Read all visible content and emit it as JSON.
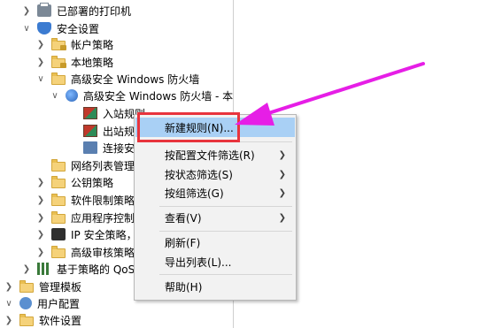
{
  "tree": {
    "printers": "已部署的打印机",
    "security_settings": "安全设置",
    "account_policy": "帐户策略",
    "local_policy": "本地策略",
    "advanced_firewall": "高级安全 Windows 防火墙",
    "advanced_firewall_local": "高级安全 Windows 防火墙 - 本",
    "inbound_rules": "入站规则",
    "outbound_rules": "出站规",
    "connection_security": "连接安",
    "network_list": "网络列表管理",
    "public_key": "公钥策略",
    "software_restriction": "软件限制策略",
    "app_control": "应用程序控制",
    "ip_security": "IP 安全策略，",
    "advanced_audit": "高级审核策略",
    "qos": "基于策略的 QoS",
    "admin_templates": "管理模板",
    "user_config": "用户配置",
    "software_settings": "软件设置"
  },
  "context_menu": {
    "new_rule": "新建规则(N)...",
    "filter_profile": "按配置文件筛选(R)",
    "filter_state": "按状态筛选(S)",
    "filter_group": "按组筛选(G)",
    "view": "查看(V)",
    "refresh": "刷新(F)",
    "export_list": "导出列表(L)...",
    "help": "帮助(H)"
  },
  "colors": {
    "highlight": "#a9d0f5",
    "callout_red": "#e8343d",
    "arrow_magenta": "#e61ee6"
  }
}
